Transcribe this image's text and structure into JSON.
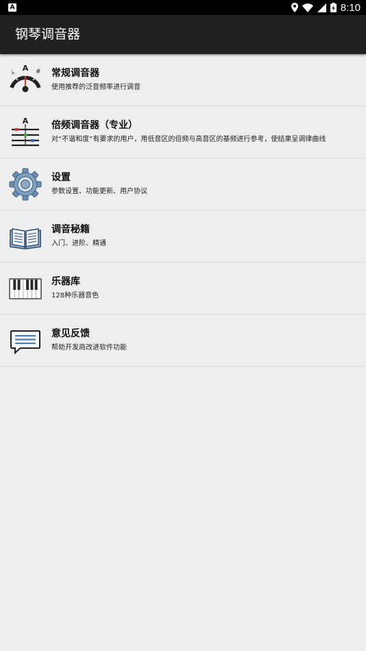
{
  "status_bar": {
    "notification_icon": "A",
    "time": "8:10",
    "icons": [
      "location-icon",
      "wifi-icon",
      "signal-icon",
      "battery-icon"
    ]
  },
  "app_bar": {
    "title": "钢琴调音器"
  },
  "menu": {
    "items": [
      {
        "title": "常规调音器",
        "subtitle": "使用推荐的泛音频率进行调音",
        "icon": "tuner-gauge-icon"
      },
      {
        "title": "倍频调音器（专业）",
        "subtitle": "对“不谐和度”有要求的用户，用低音区的倍频与高音区的基频进行参考，使结果呈调律曲线",
        "icon": "octave-tuner-icon"
      },
      {
        "title": "设置",
        "subtitle": "参数设置、功能更新、用户协议",
        "icon": "gear-icon"
      },
      {
        "title": "调音秘籍",
        "subtitle": "入门、进阶、精通",
        "icon": "book-icon"
      },
      {
        "title": "乐器库",
        "subtitle": "128种乐器音色",
        "icon": "piano-keys-icon"
      },
      {
        "title": "意见反馈",
        "subtitle": "帮助开发商改进软件功能",
        "icon": "message-icon"
      }
    ]
  },
  "tuner_labels": {
    "note": "A",
    "flat": "♭",
    "sharp": "#"
  },
  "colors": {
    "status_bar": "#000000",
    "app_bar": "#212121",
    "background": "#eeeeee",
    "divider": "#dcdcdc",
    "icon_blue": "#4a7fb8",
    "needle_red": "#d9382f"
  }
}
